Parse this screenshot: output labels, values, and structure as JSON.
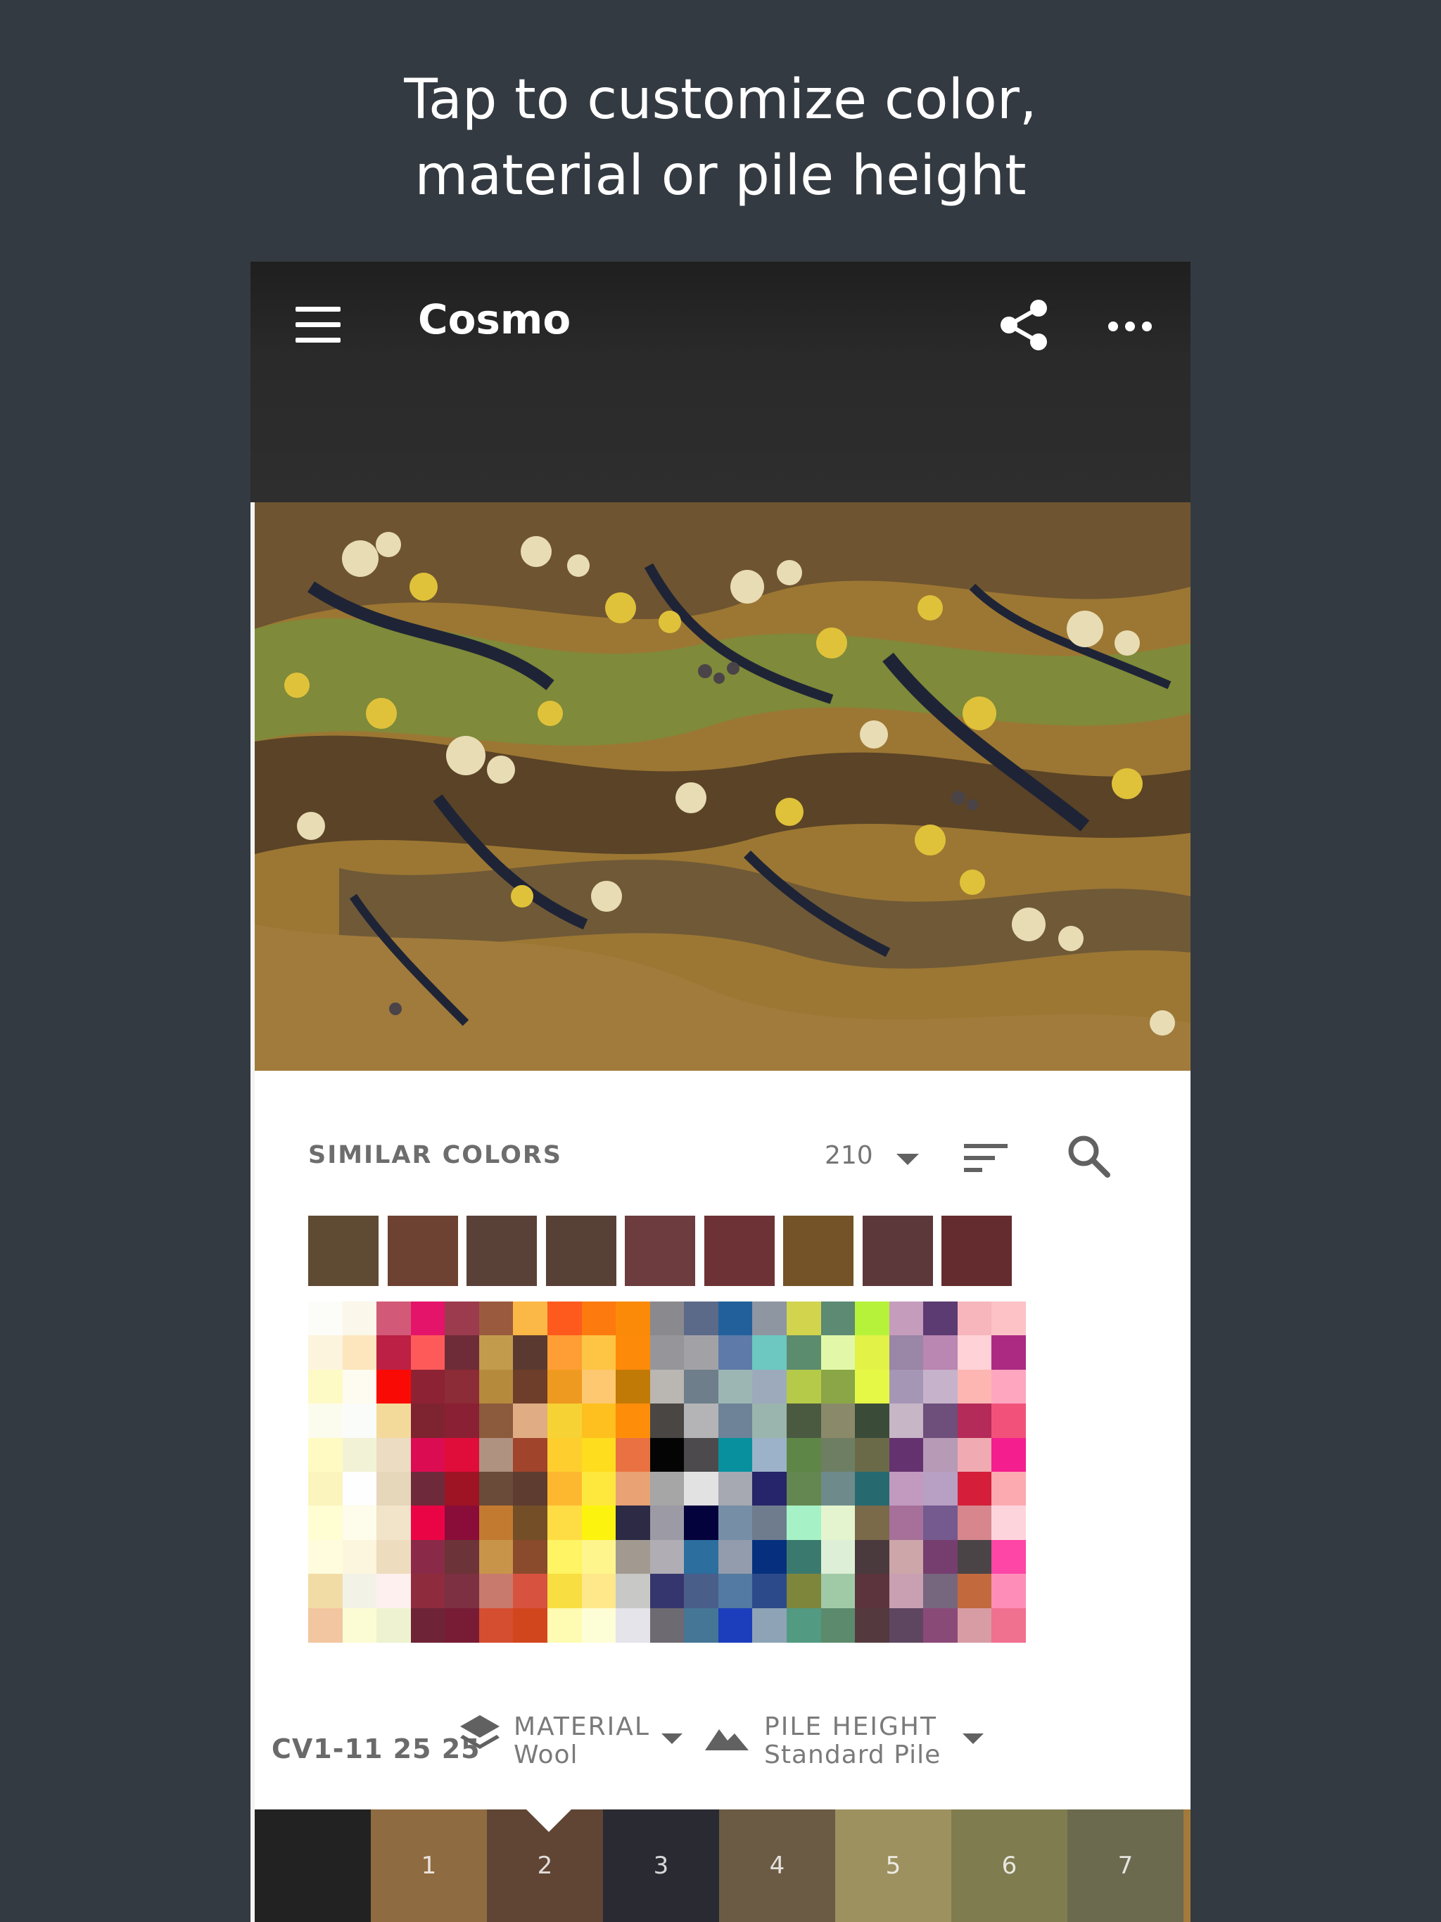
{
  "promo": {
    "line1": "Tap to customize color,",
    "line2": "material or pile height"
  },
  "app": {
    "title": "Cosmo",
    "icons": [
      "menu-icon",
      "share-icon",
      "more-icon"
    ]
  },
  "similar_colors": {
    "label": "SIMILAR COLORS",
    "count": "210",
    "swatches": [
      "#5f4a34",
      "#6e4232",
      "#5a4138",
      "#574036",
      "#6c3c3f",
      "#6d3235",
      "#735327",
      "#5d383b",
      "#652c2f"
    ]
  },
  "palette": {
    "rows": [
      [
        "#fcfcf8",
        "#fbf7ea",
        "#d25a78",
        "#e4146a",
        "#9c3a4e",
        "#9a5a3e",
        "#fbb846",
        "#fe5a1e",
        "#fc7a0e",
        "#fb8a08",
        "#8a8a8e",
        "#5c6a8a",
        "#22609c",
        "#8e96a2",
        "#d2d44e",
        "#5c8a72",
        "#b6f23a",
        "#c69cbc",
        "#5c3a72",
        "#f6b6bc",
        "#fcc2c6"
      ],
      [
        "#fdf4dd",
        "#fde6bd",
        "#bc2044",
        "#fe5a5a",
        "#6e2c38",
        "#c29c4c",
        "#5a3a30",
        "#fe9e34",
        "#fec444",
        "#fe8a0a",
        "#96969a",
        "#a2a2a6",
        "#5e7aa8",
        "#6cc8c0",
        "#5c8c6e",
        "#e2f8a8",
        "#e2f246",
        "#9a86a6",
        "#ba86b2",
        "#fed2d6",
        "#ac2a82"
      ],
      [
        "#fefac6",
        "#fefcf0",
        "#fa0a04",
        "#8c2234",
        "#8c2c36",
        "#b68a3c",
        "#6e3e2a",
        "#ee9a20",
        "#fec870",
        "#c27a06",
        "#bab6b2",
        "#6e7e8a",
        "#9cb6b4",
        "#9caabc",
        "#b6ca4a",
        "#8aa646",
        "#e6f846",
        "#a696b6",
        "#c6b2ca",
        "#feb6b2",
        "#fea6c0"
      ],
      [
        "#fcfcee",
        "#fafcfa",
        "#f4da9a",
        "#7e2430",
        "#8a2034",
        "#8c5a3c",
        "#e0ac84",
        "#f6d234",
        "#fec01e",
        "#fe8e0a",
        "#4a4644",
        "#b4b4b6",
        "#6e8298",
        "#9ab4ae",
        "#4a5a40",
        "#8a8a6a",
        "#3a4c38",
        "#c6b6c6",
        "#6e4e7a",
        "#b42a58",
        "#f2527a"
      ],
      [
        "#fefac2",
        "#f2f2d6",
        "#ecdcc2",
        "#dc0c52",
        "#e00c3a",
        "#b09280",
        "#a0442c",
        "#fece2e",
        "#fedc1e",
        "#ea7242",
        "#040404",
        "#4c4a4c",
        "#08909e",
        "#9cb2c8",
        "#5e8646",
        "#6e7e62",
        "#6a6a48",
        "#64326e",
        "#b69ab6",
        "#f0aab2",
        "#f41e8e"
      ],
      [
        "#fbf4bc",
        "#fefefe",
        "#e6d6ba",
        "#6e2a3a",
        "#9e1424",
        "#6a4a38",
        "#5e3c30",
        "#feb830",
        "#fee83e",
        "#e8a274",
        "#a6a6a6",
        "#e2e2e2",
        "#a6a8b2",
        "#26246a",
        "#648650",
        "#6e8a8a",
        "#266a70",
        "#c29ac0",
        "#b8a0c4",
        "#d41e3a",
        "#fcaab0"
      ],
      [
        "#fefed2",
        "#fefcea",
        "#f2e4c8",
        "#ea0446",
        "#8a0c38",
        "#c27a30",
        "#744e26",
        "#fedc44",
        "#fcf40e",
        "#2c2a44",
        "#9c9aa4",
        "#04023c",
        "#768ea6",
        "#6e7c8e",
        "#a6f2c6",
        "#e4f4ce",
        "#7a6a4a",
        "#a6709a",
        "#745a8e",
        "#d6868c",
        "#fed4dc"
      ],
      [
        "#fefcdc",
        "#fcf6de",
        "#eedcbe",
        "#8a2a48",
        "#6c3438",
        "#c8944a",
        "#8a4a2c",
        "#fef464",
        "#fef68c",
        "#a29a90",
        "#b0aeb4",
        "#2c6e9e",
        "#929cac",
        "#06307e",
        "#3a7a6e",
        "#ddefd6",
        "#4a3a3e",
        "#cca6a8",
        "#763e6e",
        "#4a4446",
        "#fe46a6"
      ],
      [
        "#f2dca6",
        "#f2f2e6",
        "#fef0ee",
        "#8e2c3e",
        "#7c3042",
        "#c87a6c",
        "#d85240",
        "#f8de40",
        "#fee88a",
        "#c8c8c6",
        "#36366e",
        "#4a5e8a",
        "#527aa2",
        "#2c4a8a",
        "#7e863c",
        "#a0caa6",
        "#5c343e",
        "#c8a0b2",
        "#76667e",
        "#c26a3e",
        "#fe8eb8"
      ],
      [
        "#f2c6a0",
        "#fcfcd4",
        "#eef2d0",
        "#6e2436",
        "#781c36",
        "#d64e30",
        "#d2461e",
        "#fefcb2",
        "#fefed6",
        "#e4e4ea",
        "#6e6a72",
        "#467696",
        "#1c3ebc",
        "#8ea4b6",
        "#529a82",
        "#5c8a6c",
        "#543a3e",
        "#5e4660",
        "#8a4a78",
        "#d89ca4",
        "#f07090"
      ]
    ]
  },
  "selection": {
    "code": "CV1-11 25 25",
    "material_label": "MATERIAL",
    "material_value": "Wool",
    "pile_label": "PILE HEIGHT",
    "pile_value": "Standard Pile"
  },
  "tabs": [
    {
      "label": "",
      "color": "#222222"
    },
    {
      "label": "1",
      "color": "#8f6b42"
    },
    {
      "label": "2",
      "color": "#604535"
    },
    {
      "label": "3",
      "color": "#2a2a32"
    },
    {
      "label": "4",
      "color": "#6b5b44"
    },
    {
      "label": "5",
      "color": "#9d9160"
    },
    {
      "label": "6",
      "color": "#7f7d50"
    },
    {
      "label": "7",
      "color": "#6b6a4f"
    },
    {
      "label": "",
      "color": "#a37a3a"
    }
  ],
  "selected_tab": "2"
}
